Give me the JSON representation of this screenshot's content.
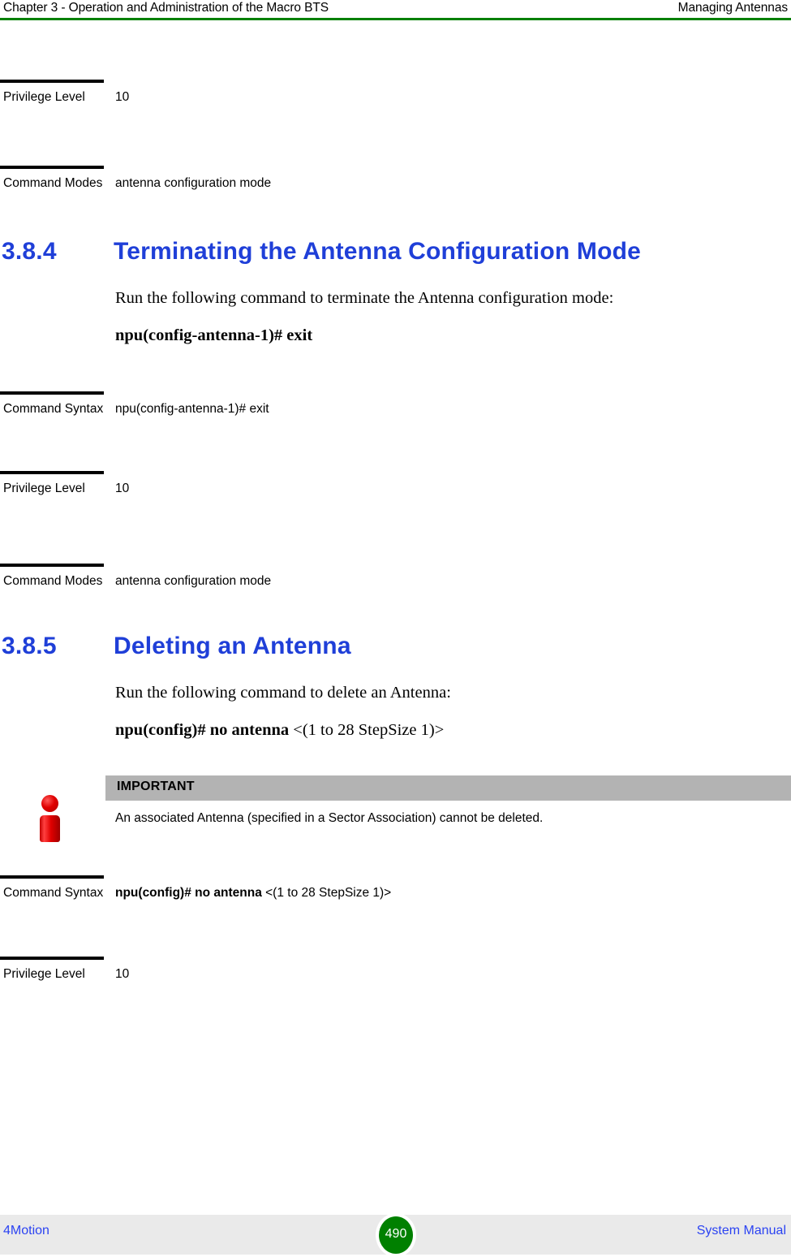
{
  "header": {
    "left": "Chapter 3 - Operation and Administration of the Macro BTS",
    "right": "Managing Antennas",
    "rule_color": "#008000"
  },
  "rows_top": [
    {
      "label": "Privilege Level",
      "value": "10"
    },
    {
      "label": "Command Modes",
      "value": "antenna configuration mode"
    }
  ],
  "section_384": {
    "number": "3.8.4",
    "title": "Terminating the Antenna Configuration Mode",
    "intro": "Run the following command to terminate the Antenna configuration mode:",
    "command_bold": "npu(config-antenna-1)# exit",
    "rows": [
      {
        "label": "Command Syntax",
        "value": "npu(config-antenna-1)# exit"
      },
      {
        "label": "Privilege Level",
        "value": "10"
      },
      {
        "label": "Command Modes",
        "value": "antenna configuration mode"
      }
    ]
  },
  "section_385": {
    "number": "3.8.5",
    "title": "Deleting an Antenna",
    "intro": "Run the following command to delete an Antenna:",
    "command_bold": "npu(config)# no antenna",
    "command_rest": " <(1 to 28 StepSize 1)>",
    "important": {
      "icon": "info-icon",
      "label": "IMPORTANT",
      "text": "An associated Antenna (specified in a Sector Association) cannot be deleted.",
      "bar_color": "#B3B3B3",
      "icon_color": "#D00000"
    },
    "rows": [
      {
        "label": "Command Syntax",
        "value_bold": "npu(config)# no antenna",
        "value_rest": " <(1 to 28 StepSize 1)>"
      },
      {
        "label": "Privilege Level",
        "value": "10"
      }
    ]
  },
  "footer": {
    "left": "4Motion",
    "page": "490",
    "right": "System Manual",
    "link_color": "#2B43F2",
    "badge_color": "#008000",
    "band_color": "#EAEAEA"
  }
}
